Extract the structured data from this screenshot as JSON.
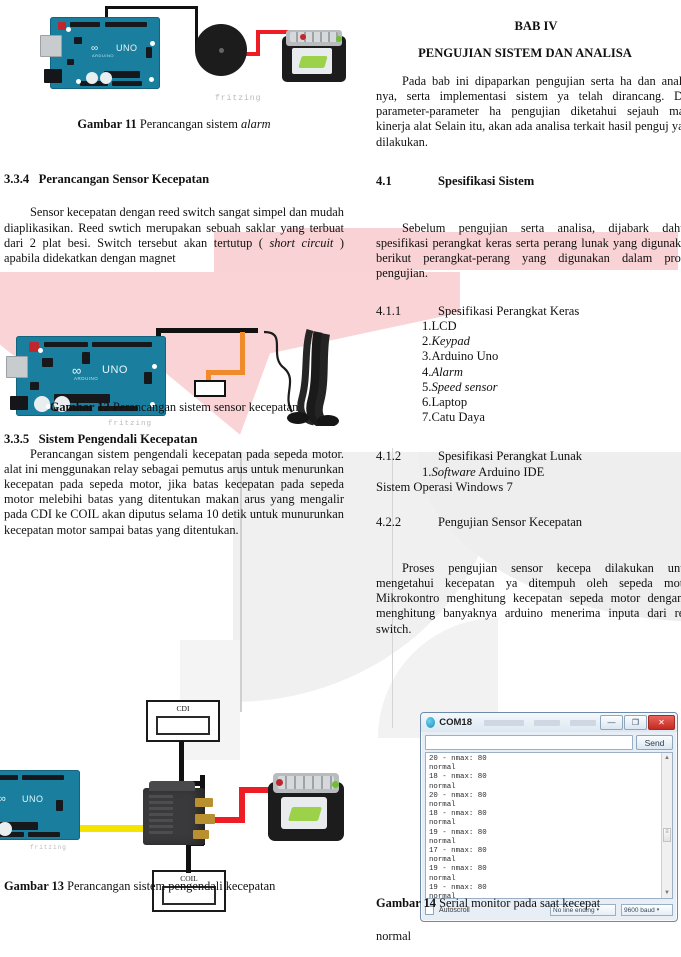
{
  "document": {
    "chapter_label": "BAB IV",
    "chapter_title": "PENGUJIAN SISTEM DAN ANALISA"
  },
  "left_column": {
    "figure11_caption_bold": "Gambar 11",
    "figure11_caption_rest": " Perancangan sistem ",
    "figure11_caption_italic": "alarm",
    "section_334_num": "3.3.4",
    "section_334_title": "Perancangan Sensor Kecepatan",
    "para_334_a": "Sensor kecepatan dengan reed switch sangat simpel dan mudah diaplikasikan. Reed swtich merupakan sebuah saklar yang terbuat dari 2 plat besi. Switch tersebut akan tertutup ( ",
    "para_334_italic": "short circuit",
    "para_334_b": " ) apabila didekatkan dengan magnet",
    "figure12_caption_bold": "Gambar 12",
    "figure12_caption_rest": " Perancangan sistem sensor kecepatan",
    "section_335_num": "3.3.5",
    "section_335_title": "Sistem Pengendali Kecepatan",
    "para_335": "Perancangan sistem pengendali kecepatan pada sepeda motor. alat ini menggunakan relay sebagai pemutus arus untuk menurunkan kecepatan pada sepeda motor, jika batas kecepatan pada sepeda motor melebihi batas yang ditentukan makan arus yang mengalir pada CDI ke COIL akan diputus selama 10 detik untuk munurunkan kecepatan motor sampai batas yang ditentukan.",
    "figure13_caption_bold": "Gambar 13",
    "figure13_caption_rest": "Perancangan sistem pengendali kecepatan"
  },
  "right_column": {
    "intro_para": "Pada bab ini dipaparkan pengujian serta ha dan analisa nya, serta implementasi sistem ya telah dirancang. Dari parameter-parameter ha pengujian diketahui sejauh mana kinerja alat Selain itu, akan ada analisa terkait hasil penguj yang dilakukan.",
    "section_41_num": "4.1",
    "section_41_title": "Spesifikasi Sistem",
    "para_41": "Sebelum pengujian serta analisa, dijabark dahulu spesifikasi perangkat keras serta perang lunak yang digunakan, berikut perangkat-perang yang digunakan dalam proses pengujian.",
    "section_411_num": "4.1.1",
    "section_411_title": "Spesifikasi Perangkat Keras",
    "hardware_list": [
      {
        "num": "1.",
        "text": "LCD",
        "italic": false
      },
      {
        "num": "2.",
        "text": "Keypad",
        "italic": true
      },
      {
        "num": "3.",
        "text": "Arduino Uno",
        "italic": false
      },
      {
        "num": "4.",
        "text": "Alarm",
        "italic": true
      },
      {
        "num": "5.",
        "text": "Speed sensor",
        "italic": true
      },
      {
        "num": "6.",
        "text": "Laptop",
        "italic": false
      },
      {
        "num": "7.",
        "text": "Catu Daya",
        "italic": false
      }
    ],
    "section_412_num": "4.1.2",
    "section_412_title": "Spesifikasi Perangkat Lunak",
    "software_item_num": "1.",
    "software_item_italic": "Software",
    "software_item_rest": " Arduino IDE",
    "software_os": "Sistem Operasi Windows 7",
    "section_422_num": "4.2.2",
    "section_422_title": "Pengujian Sensor Kecepatan",
    "para_422": "Proses pengujian sensor kecepa dilakukan untuk mengetahui kecepatan ya ditempuh oleh sepeda motor. Mikrokontro menghitung kecepatan sepeda motor dengan c menghitung banyaknya arduino menerima inputa dari reed switch.",
    "figure14_caption_bold": "Gambar 14",
    "figure14_caption_rest": "Serial monitor pada saat kecepat",
    "figure14_caption_line2": "normal"
  },
  "serial_monitor": {
    "window_title": "COM18",
    "minimize_glyph": "—",
    "maximize_glyph": "❐",
    "close_glyph": "✕",
    "input_value": "",
    "input_placeholder": "",
    "send_label": "Send",
    "scroll_up_glyph": "▲",
    "scroll_down_glyph": "▼",
    "scroll_thumb_glyph": "≡",
    "console_text": "20 - nmax: 80\nnormal\n18 - nmax: 80\nnormal\n20 - nmax: 80\nnormal\n18 - nmax: 80\nnormal\n19 - nmax: 80\nnormal\n17 - nmax: 80\nnormal\n19 - nmax: 80\nnormal\n19 - nmax: 80\nnormal",
    "autoscroll_label": "Autoscroll",
    "line_ending_value": "No line ending",
    "baud_value": "9600 baud",
    "dropdown_glyph": "▾"
  },
  "diagrams": {
    "fritzing_watermark": "fritzing",
    "arduino_logo": "UNO",
    "arduino_brand": "ARDUINO",
    "cdi_label": "CDI",
    "coil_label": "COIL"
  },
  "colors": {
    "pink_watermark": "#f8d2d4",
    "grey_watermark": "#f0f0f0",
    "arduino_teal": "#1a7f9e",
    "wire_red": "#ee1c25",
    "wire_black": "#111111",
    "wire_yellow": "#f5e400",
    "wire_orange": "#f08a2a",
    "serial_chrome": "#e7eef5"
  }
}
